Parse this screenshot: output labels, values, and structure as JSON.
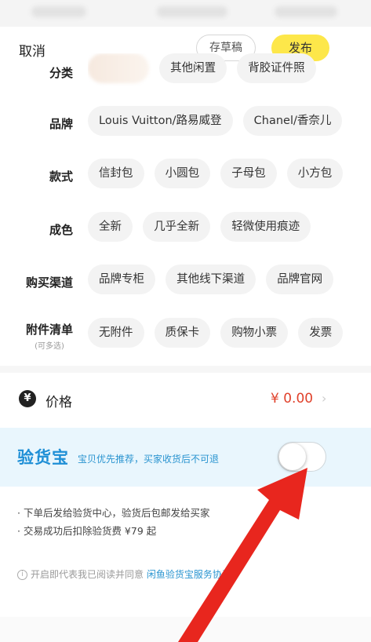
{
  "header": {
    "cancel": "取消",
    "draft": "存草稿",
    "publish": "发布"
  },
  "rows": [
    {
      "label": "分类",
      "chips": [
        "其他闲置",
        "背胶证件照"
      ]
    },
    {
      "label": "品牌",
      "chips": [
        "Louis Vuitton/路易威登",
        "Chanel/香奈儿"
      ]
    },
    {
      "label": "款式",
      "chips": [
        "信封包",
        "小圆包",
        "子母包",
        "小方包"
      ]
    },
    {
      "label": "成色",
      "chips": [
        "全新",
        "几乎全新",
        "轻微使用痕迹"
      ]
    },
    {
      "label": "购买渠道",
      "chips": [
        "品牌专柜",
        "其他线下渠道",
        "品牌官网"
      ]
    },
    {
      "label": "附件清单",
      "sublabel": "(可多选)",
      "chips": [
        "无附件",
        "质保卡",
        "购物小票",
        "发票"
      ]
    }
  ],
  "price": {
    "label": "价格",
    "value": "¥ 0.00",
    "icon": "yen-circle-icon"
  },
  "yanhuobao": {
    "title": "验货宝",
    "desc": "宝贝优先推荐，买家收货后不可退",
    "enabled": false
  },
  "notes": [
    "· 下单后发给验货中心，验货后包邮发给买家",
    "· 交易成功后扣除验货费 ¥79 起"
  ],
  "agreement": {
    "prefix": "开启即代表我已阅读并同意",
    "link": "闲鱼验货宝服务协议"
  },
  "colors": {
    "accent_yellow": "#fde74a",
    "price_red": "#e0412b",
    "yhb_blue": "#1f8fd6",
    "arrow_red": "#e8261e"
  }
}
